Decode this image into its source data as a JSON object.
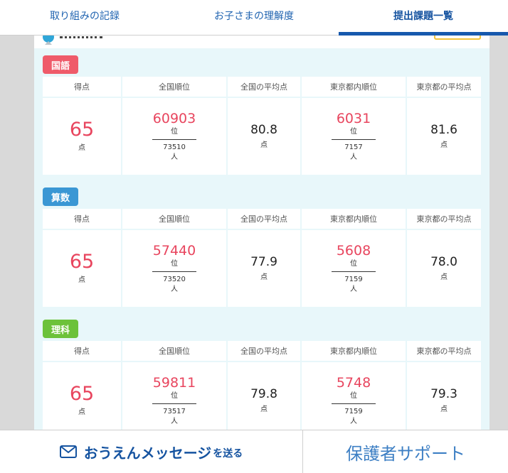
{
  "tabs": [
    {
      "label": "取り組みの記録",
      "active": false
    },
    {
      "label": "お子さまの理解度",
      "active": false
    },
    {
      "label": "提出課題一覧",
      "active": true
    }
  ],
  "columns": [
    "得点",
    "全国順位",
    "全国の平均点",
    "東京都内順位",
    "東京都の平均点"
  ],
  "units": {
    "score": "点",
    "rank": "位",
    "people": "人",
    "avg": "点"
  },
  "subjects": [
    {
      "name": "国語",
      "color": "#ef5b6a",
      "score": "65",
      "national_rank": "60903",
      "national_total": "73510",
      "national_avg": "80.8",
      "tokyo_rank": "6031",
      "tokyo_total": "7157",
      "tokyo_avg": "81.6"
    },
    {
      "name": "算数",
      "color": "#3a97d4",
      "score": "65",
      "national_rank": "57440",
      "national_total": "73520",
      "national_avg": "77.9",
      "tokyo_rank": "5608",
      "tokyo_total": "7159",
      "tokyo_avg": "78.0"
    },
    {
      "name": "理科",
      "color": "#6cc23a",
      "score": "65",
      "national_rank": "59811",
      "national_total": "73517",
      "national_avg": "79.8",
      "tokyo_rank": "5748",
      "tokyo_total": "7159",
      "tokyo_avg": "79.3"
    }
  ],
  "bottom": {
    "message_main": "おうえんメッセージ",
    "message_suffix": "を送る",
    "message_icon": "mail-icon",
    "support_label": "保護者サポート"
  }
}
